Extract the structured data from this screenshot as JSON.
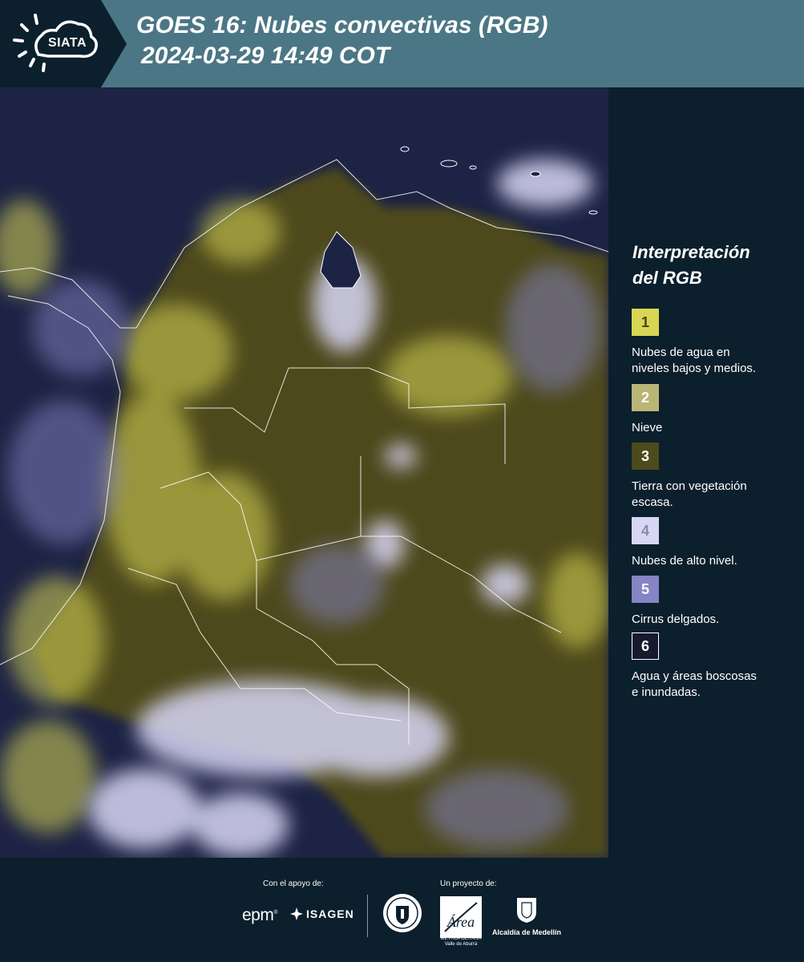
{
  "header": {
    "logo_text": "SIATA",
    "title_line1": "GOES 16: Nubes convectivas (RGB)",
    "title_line2": "2024-03-29 14:49 COT"
  },
  "legend": {
    "title_line1": "Interpretación",
    "title_line2": "del RGB",
    "items": [
      {
        "number": "1",
        "line1": "Nubes de agua en",
        "line2": "niveles bajos y medios.",
        "color": "#d8d655",
        "text_color": "#444420"
      },
      {
        "number": "2",
        "line1": "Nieve",
        "line2": "",
        "color": "#b9b676",
        "text_color": "#ffffff"
      },
      {
        "number": "3",
        "line1": "Tierra con vegetación",
        "line2": "escasa.",
        "color": "#4d4a1c",
        "text_color": "#ffffff"
      },
      {
        "number": "4",
        "line1": "Nubes de alto nivel.",
        "line2": "",
        "color": "#d8d6f5",
        "text_color": "#8a89a8"
      },
      {
        "number": "5",
        "line1": "Cirrus delgados.",
        "line2": "",
        "color": "#8584c5",
        "text_color": "#ffffff"
      },
      {
        "number": "6",
        "line1": "Agua y áreas boscosas",
        "line2": "e inundadas.",
        "color": "#151a2e",
        "text_color": "#ffffff"
      }
    ]
  },
  "footer": {
    "support_label": "Con el apoyo de:",
    "project_label": "Un proyecto de:",
    "epm": "epm",
    "isagen": "ISAGEN",
    "area_script": "Área",
    "area_line1": "METROPOLITANA",
    "area_line2": "Valle de Aburrá",
    "alcaldia": "Alcaldía de Medellín"
  },
  "colors": {
    "header_bg": "#4b7685",
    "panel_bg": "#0c1f2c",
    "water": "#1d2344",
    "land": "#4d4a1c",
    "low_cloud": "#d8d655",
    "high_cloud": "#d8d6f5",
    "cirrus": "#8584c5"
  }
}
